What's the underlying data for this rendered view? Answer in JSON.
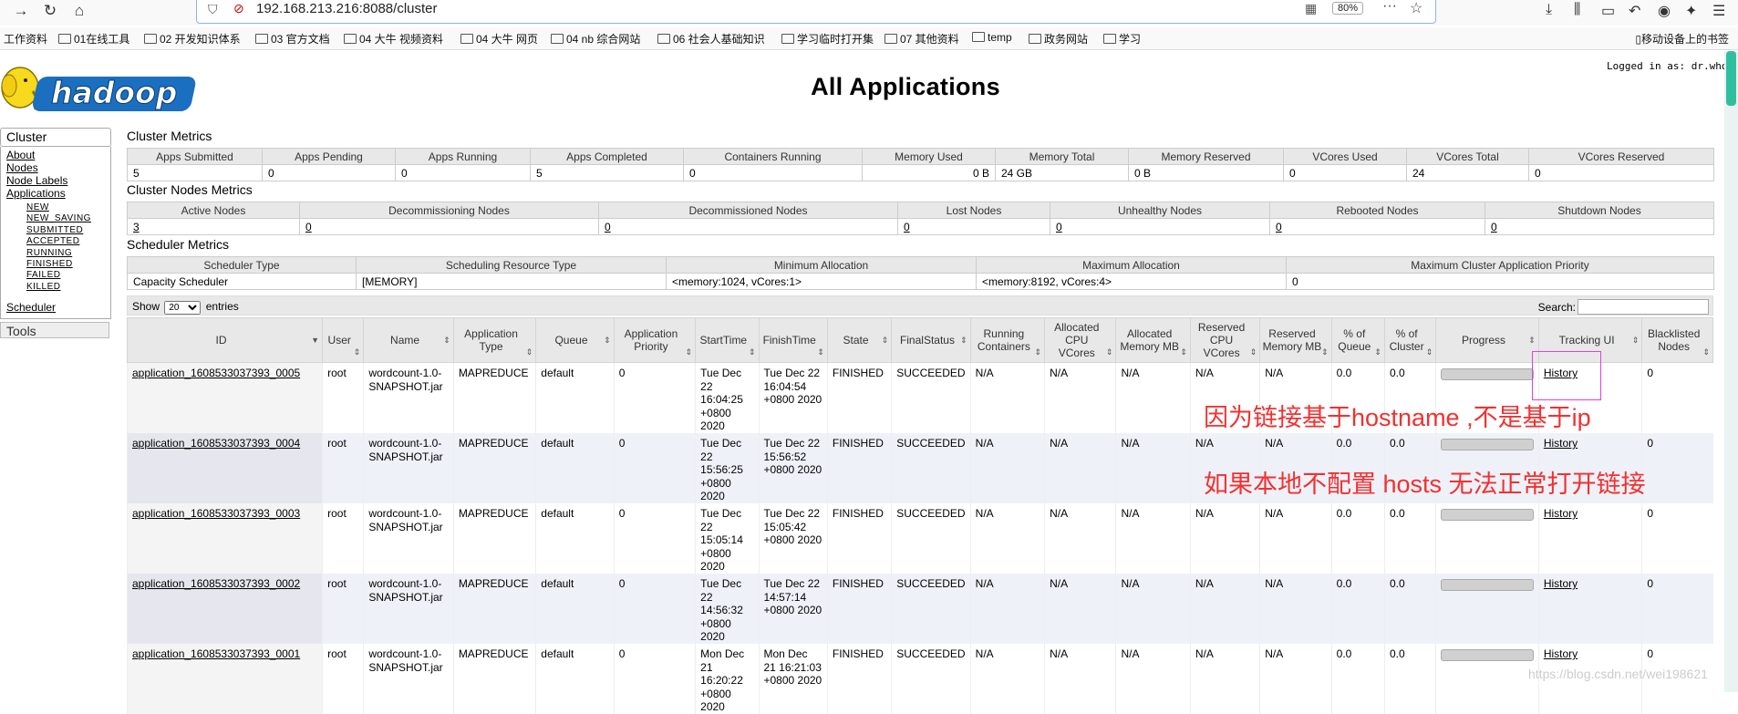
{
  "browser": {
    "url": "192.168.213.216:8088/cluster",
    "zoom": "80%",
    "bookmarks": [
      "工作资料",
      "01在线工具",
      "02 开发知识体系",
      "03 官方文档",
      "04 大牛 视频资料",
      "04 大牛 网页",
      "04 nb 综合网站",
      "06 社会人基础知识",
      "学习临时打开集",
      "07 其他资料",
      "temp",
      "政务网站",
      "学习"
    ],
    "mobile_bookmarks": "移动设备上的书签"
  },
  "page": {
    "logo_text": "hadoop",
    "title": "All Applications",
    "logged_in": "Logged in as: dr.who"
  },
  "sidebar": {
    "cluster_head": "Cluster",
    "links": [
      "About",
      "Nodes",
      "Node Labels",
      "Applications"
    ],
    "app_states": [
      "NEW",
      "NEW_SAVING",
      "SUBMITTED",
      "ACCEPTED",
      "RUNNING",
      "FINISHED",
      "FAILED",
      "KILLED"
    ],
    "scheduler": "Scheduler",
    "tools_head": "Tools"
  },
  "cluster_metrics": {
    "title": "Cluster Metrics",
    "headers": [
      "Apps Submitted",
      "Apps Pending",
      "Apps Running",
      "Apps Completed",
      "Containers Running",
      "Memory Used",
      "Memory Total",
      "Memory Reserved",
      "VCores Used",
      "VCores Total",
      "VCores Reserved"
    ],
    "values": [
      "5",
      "0",
      "0",
      "5",
      "0",
      "0 B",
      "24 GB",
      "0 B",
      "0",
      "24",
      "0"
    ]
  },
  "node_metrics": {
    "title": "Cluster Nodes Metrics",
    "headers": [
      "Active Nodes",
      "Decommissioning Nodes",
      "Decommissioned Nodes",
      "Lost Nodes",
      "Unhealthy Nodes",
      "Rebooted Nodes",
      "Shutdown Nodes"
    ],
    "values": [
      "3",
      "0",
      "0",
      "0",
      "0",
      "0",
      "0"
    ]
  },
  "scheduler_metrics": {
    "title": "Scheduler Metrics",
    "headers": [
      "Scheduler Type",
      "Scheduling Resource Type",
      "Minimum Allocation",
      "Maximum Allocation",
      "Maximum Cluster Application Priority"
    ],
    "values": [
      "Capacity Scheduler",
      "[MEMORY]",
      "<memory:1024, vCores:1>",
      "<memory:8192, vCores:4>",
      "0"
    ]
  },
  "apps_controls": {
    "show": "Show",
    "page_size": "20",
    "entries": "entries",
    "search": "Search:"
  },
  "apps": {
    "headers": [
      "ID",
      "User",
      "Name",
      "Application Type",
      "Queue",
      "Application Priority",
      "StartTime",
      "FinishTime",
      "State",
      "FinalStatus",
      "Running Containers",
      "Allocated CPU VCores",
      "Allocated Memory MB",
      "Reserved CPU VCores",
      "Reserved Memory MB",
      "% of Queue",
      "% of Cluster",
      "Progress",
      "Tracking UI",
      "Blacklisted Nodes"
    ],
    "rows": [
      {
        "id": "application_1608533037393_0005",
        "user": "root",
        "name": "wordcount-1.0-SNAPSHOT.jar",
        "type": "MAPREDUCE",
        "queue": "default",
        "priority": "0",
        "start": "Tue Dec 22 16:04:25 +0800 2020",
        "finish": "Tue Dec 22 16:04:54 +0800 2020",
        "state": "FINISHED",
        "final": "SUCCEEDED",
        "running": "N/A",
        "cpu": "N/A",
        "mem": "N/A",
        "rcpu": "N/A",
        "rmem": "N/A",
        "pq": "0.0",
        "pc": "0.0",
        "progress": 100,
        "tracking": "History",
        "blacklisted": "0"
      },
      {
        "id": "application_1608533037393_0004",
        "user": "root",
        "name": "wordcount-1.0-SNAPSHOT.jar",
        "type": "MAPREDUCE",
        "queue": "default",
        "priority": "0",
        "start": "Tue Dec 22 15:56:25 +0800 2020",
        "finish": "Tue Dec 22 15:56:52 +0800 2020",
        "state": "FINISHED",
        "final": "SUCCEEDED",
        "running": "N/A",
        "cpu": "N/A",
        "mem": "N/A",
        "rcpu": "N/A",
        "rmem": "N/A",
        "pq": "0.0",
        "pc": "0.0",
        "progress": 100,
        "tracking": "History",
        "blacklisted": "0"
      },
      {
        "id": "application_1608533037393_0003",
        "user": "root",
        "name": "wordcount-1.0-SNAPSHOT.jar",
        "type": "MAPREDUCE",
        "queue": "default",
        "priority": "0",
        "start": "Tue Dec 22 15:05:14 +0800 2020",
        "finish": "Tue Dec 22 15:05:42 +0800 2020",
        "state": "FINISHED",
        "final": "SUCCEEDED",
        "running": "N/A",
        "cpu": "N/A",
        "mem": "N/A",
        "rcpu": "N/A",
        "rmem": "N/A",
        "pq": "0.0",
        "pc": "0.0",
        "progress": 100,
        "tracking": "History",
        "blacklisted": "0"
      },
      {
        "id": "application_1608533037393_0002",
        "user": "root",
        "name": "wordcount-1.0-SNAPSHOT.jar",
        "type": "MAPREDUCE",
        "queue": "default",
        "priority": "0",
        "start": "Tue Dec 22 14:56:32 +0800 2020",
        "finish": "Tue Dec 22 14:57:14 +0800 2020",
        "state": "FINISHED",
        "final": "SUCCEEDED",
        "running": "N/A",
        "cpu": "N/A",
        "mem": "N/A",
        "rcpu": "N/A",
        "rmem": "N/A",
        "pq": "0.0",
        "pc": "0.0",
        "progress": 100,
        "tracking": "History",
        "blacklisted": "0"
      },
      {
        "id": "application_1608533037393_0001",
        "user": "root",
        "name": "wordcount-1.0-SNAPSHOT.jar",
        "type": "MAPREDUCE",
        "queue": "default",
        "priority": "0",
        "start": "Mon Dec 21 16:20:22 +0800 2020",
        "finish": "Mon Dec 21 16:21:03 +0800 2020",
        "state": "FINISHED",
        "final": "SUCCEEDED",
        "running": "N/A",
        "cpu": "N/A",
        "mem": "N/A",
        "rcpu": "N/A",
        "rmem": "N/A",
        "pq": "0.0",
        "pc": "0.0",
        "progress": 100,
        "tracking": "History",
        "blacklisted": "0"
      }
    ]
  },
  "annotations": {
    "line1": "因为链接基于hostname ,不是基于ip",
    "line2": "如果本地不配置 hosts 无法正常打开链接",
    "color": "#f23030"
  },
  "watermark": "https://blog.csdn.net/wei198621"
}
